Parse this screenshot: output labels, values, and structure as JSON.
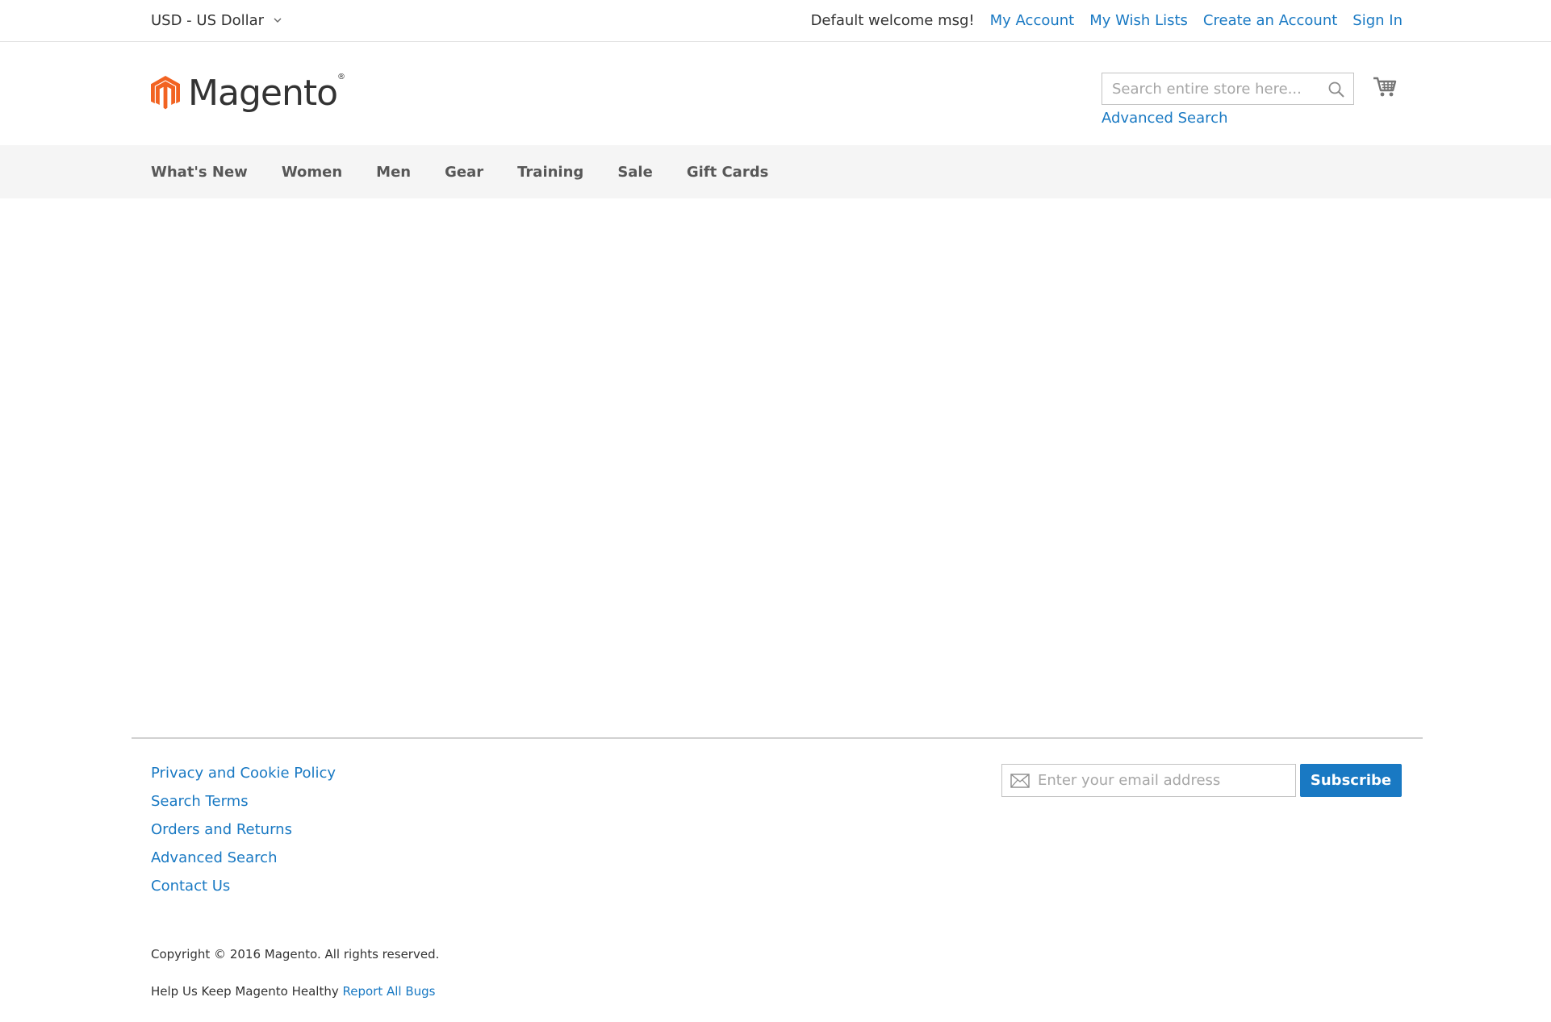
{
  "header": {
    "currency": "USD - US Dollar",
    "welcome": "Default welcome msg!",
    "links": [
      "My Account",
      "My Wish Lists",
      "Create an Account",
      "Sign In"
    ]
  },
  "logo": {
    "text": "Magento",
    "registered": "®"
  },
  "search": {
    "placeholder": "Search entire store here...",
    "advanced_label": "Advanced Search",
    "icon": "search-icon"
  },
  "cart": {
    "icon": "cart-icon"
  },
  "nav": {
    "items": [
      "What's New",
      "Women",
      "Men",
      "Gear",
      "Training",
      "Sale",
      "Gift Cards"
    ]
  },
  "footer": {
    "links": [
      "Privacy and Cookie Policy",
      "Search Terms",
      "Orders and Returns",
      "Advanced Search",
      "Contact Us"
    ],
    "newsletter": {
      "placeholder": "Enter your email address",
      "button_label": "Subscribe",
      "icon": "envelope-icon"
    },
    "copyright": "Copyright © 2016 Magento. All rights reserved.",
    "bugs_prefix": "Help Us Keep Magento Healthy",
    "bugs_link": "Report All Bugs"
  },
  "colors": {
    "link": "#1979c3",
    "logo_orange": "#f26322",
    "nav_bg": "#f5f5f5",
    "button": "#1979c3"
  }
}
